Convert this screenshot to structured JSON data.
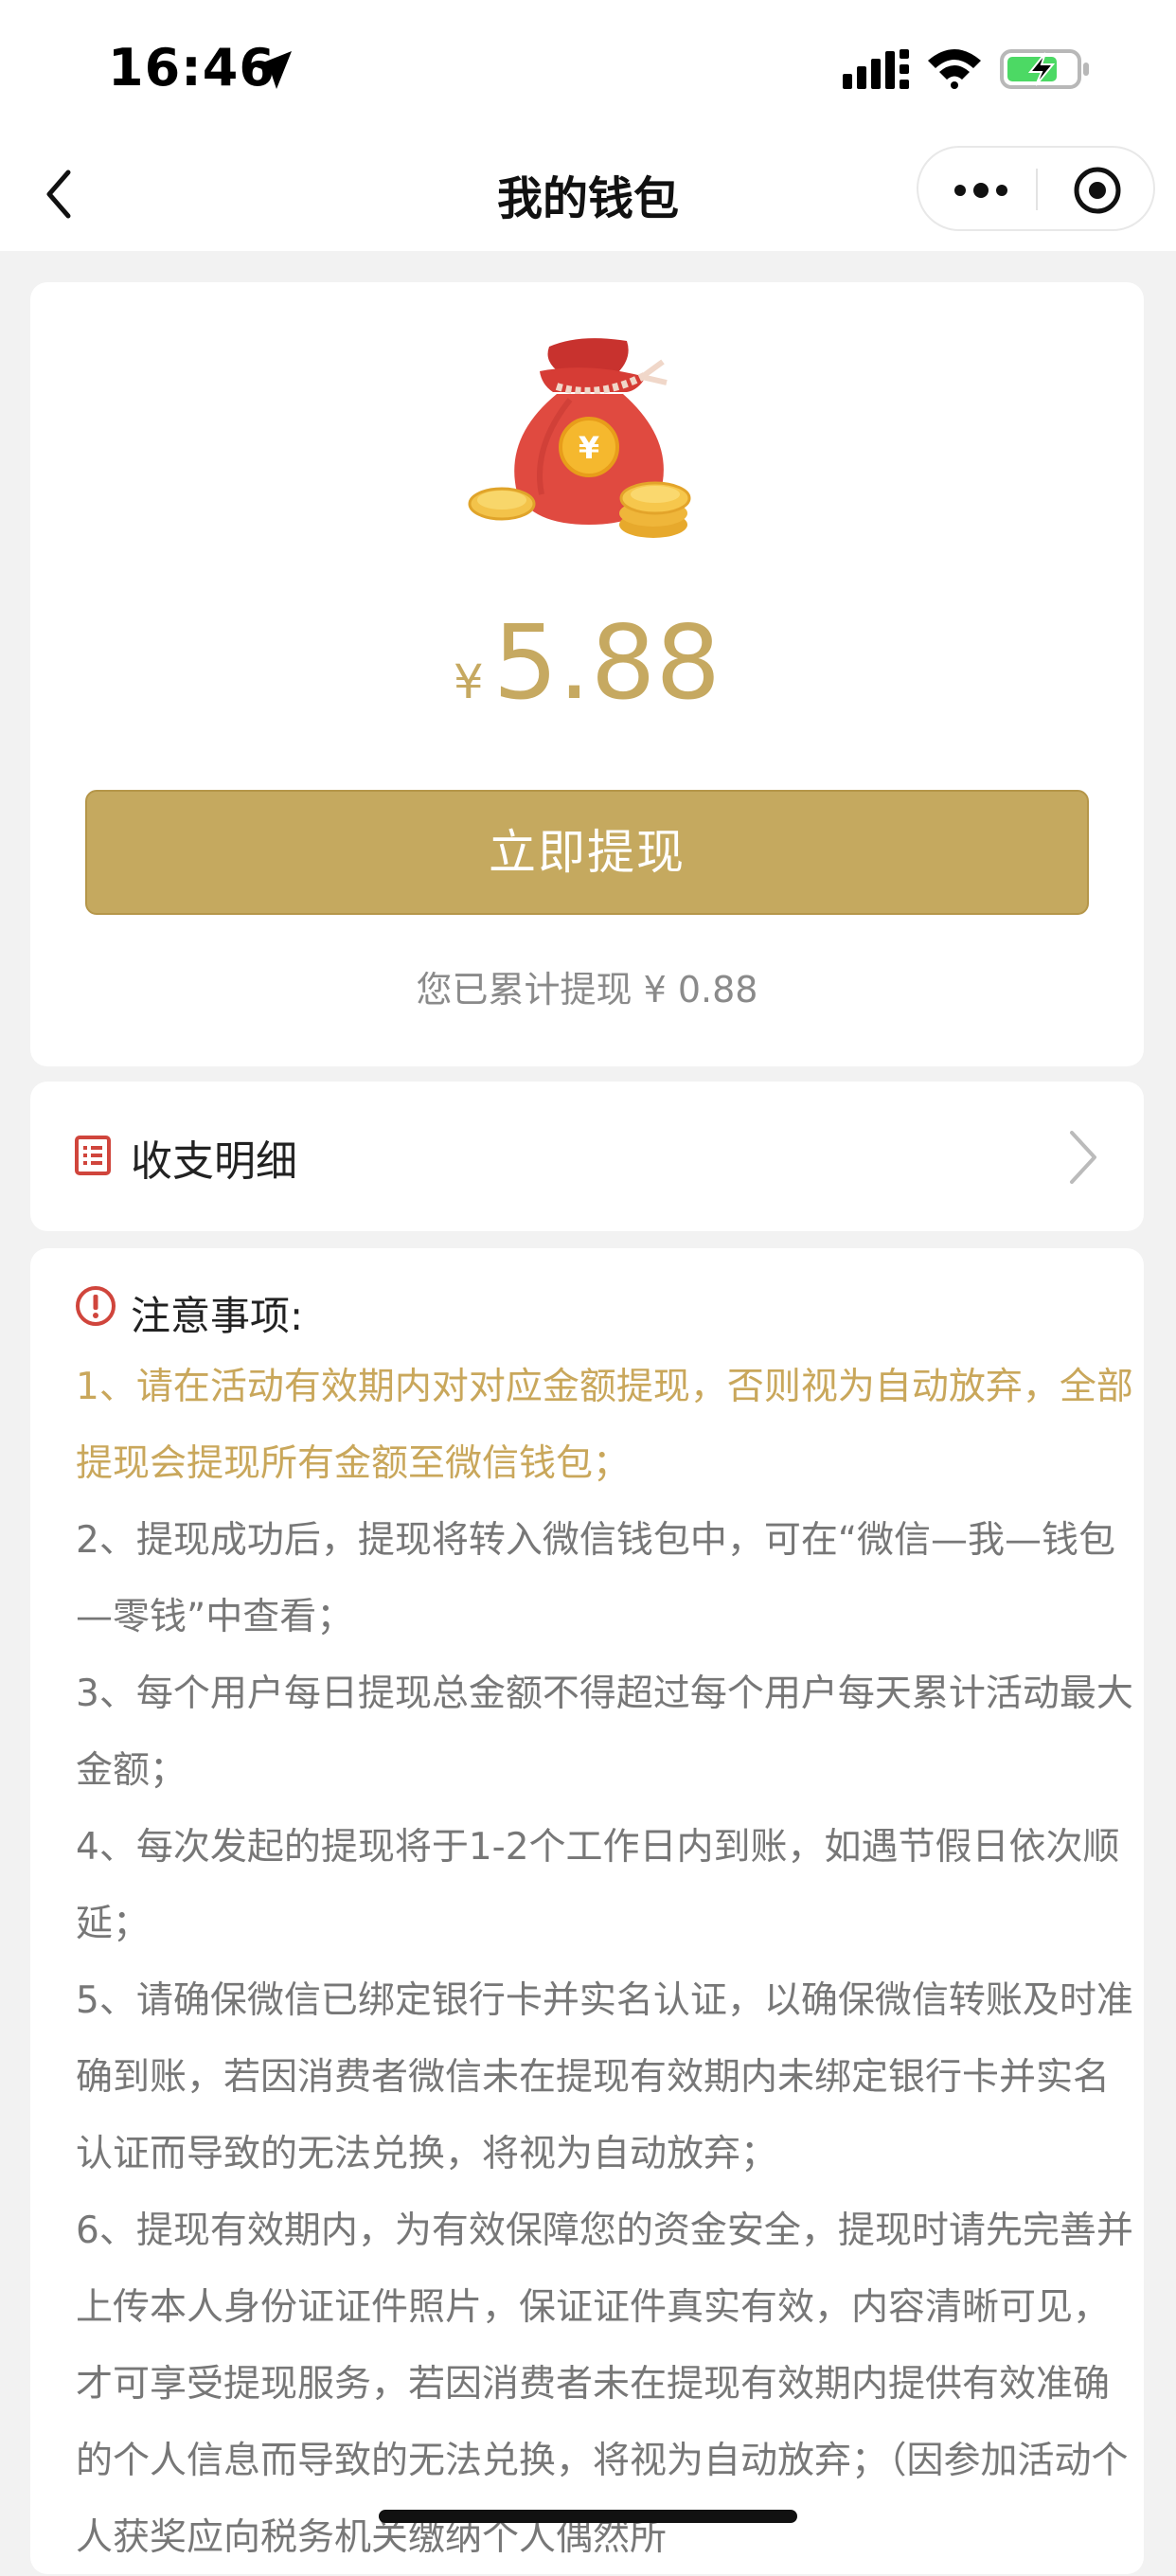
{
  "status_bar": {
    "time": "16:46",
    "icons": [
      "location-arrow-icon",
      "signal-icon",
      "wifi-icon",
      "battery-charging-icon"
    ]
  },
  "nav": {
    "title": "我的钱包",
    "icons": [
      "back-icon",
      "more-icon",
      "target-icon"
    ]
  },
  "wallet": {
    "currency_symbol": "¥",
    "balance": "5.88",
    "withdraw_button": "立即提现",
    "total_withdrawn": "您已累计提现 ¥ 0.88",
    "icon": "money-bag-icon"
  },
  "detail": {
    "label": "收支明细",
    "icon": "list-icon"
  },
  "notice": {
    "title": "注意事项:",
    "icon": "warning-icon",
    "items": [
      "1、请在活动有效期内对对应金额提现，否则视为自动放弃，全部提现会提现所有金额至微信钱包；",
      "2、提现成功后，提现将转入微信钱包中，可在“微信—我—钱包—零钱”中查看；",
      "3、每个用户每日提现总金额不得超过每个用户每天累计活动最大金额；",
      "4、每次发起的提现将于1-2个工作日内到账，如遇节假日依次顺延；",
      "5、请确保微信已绑定银行卡并实名认证，以确保微信转账及时准确到账，若因消费者微信未在提现有效期内未绑定银行卡并实名认证而导致的无法兑换，将视为自动放弃；",
      "6、提现有效期内，为有效保障您的资金安全，提现时请先完善并上传本人身份证证件照片，保证证件真实有效，内容清晰可见，才可享受提现服务，若因消费者未在提现有效期内提供有效准确的个人信息而导致的无法兑换，将视为自动放弃；（因参加活动个人获奖应向税务机关缴纳个人偶然所"
    ]
  },
  "colors": {
    "gold": "#c5a95f",
    "highlight_text": "#c9a75b",
    "body_text": "#777777",
    "warning_red": "#d0453c"
  }
}
